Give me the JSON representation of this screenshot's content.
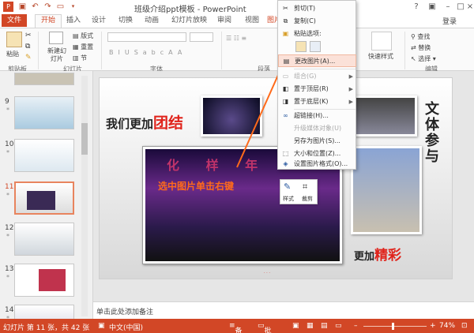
{
  "title_bar": {
    "title": "班级介绍ppt模板 - PowerPoint",
    "help": "?"
  },
  "tabs": {
    "file": "文件",
    "home": "开始",
    "insert": "插入",
    "design": "设计",
    "transitions": "切换",
    "animations": "动画",
    "slideshow": "幻灯片放映",
    "review": "审阅",
    "view": "视图",
    "picture": "图片",
    "login": "登录"
  },
  "ribbon": {
    "paste": "粘贴",
    "new_slide": "新建幻灯片",
    "layout": "版式",
    "reset": "重置",
    "section": "节",
    "quick_styles": "快速样式",
    "find": "查找",
    "replace": "替换",
    "select": "选择",
    "groups": {
      "clipboard": "剪贴板",
      "slides": "幻灯片",
      "font": "字体",
      "paragraph": "段落",
      "editing": "编辑"
    }
  },
  "thumbnails": [
    {
      "num": "9",
      "star": "*"
    },
    {
      "num": "10",
      "star": "*"
    },
    {
      "num": "11",
      "star": "*"
    },
    {
      "num": "12",
      "star": "*"
    },
    {
      "num": "13",
      "star": "*"
    },
    {
      "num": "14",
      "star": "*"
    }
  ],
  "slide": {
    "text1_a": "我们更加",
    "text1_b": "团结",
    "vertical": "文体参与",
    "text2_a": "更加",
    "text2_b": "精彩",
    "banner": "化 样 年",
    "annotation": "选中图片单击右键",
    "footer_mark": "· · ·"
  },
  "mini_toolbar": {
    "style": "样式",
    "crop": "裁剪"
  },
  "context_menu": {
    "cut": "剪切(T)",
    "copy": "复制(C)",
    "paste_options": "粘贴选项:",
    "change_picture": "更改图片(A)...",
    "group": "组合(G)",
    "bring_front": "置于顶层(R)",
    "send_back": "置于底层(K)",
    "hyperlink": "超链接(H)...",
    "upgrade_media": "升级媒体对象(U)",
    "save_as_picture": "另存为图片(S)...",
    "size_position": "大小和位置(Z)...",
    "format_picture": "设置图片格式(O)..."
  },
  "notes": {
    "placeholder": "单击此处添加备注"
  },
  "status": {
    "slide_info": "幻灯片 第 11 张，共 42 张",
    "language": "中文(中国)",
    "notes": "备注",
    "comments": "批注",
    "zoom": "74%"
  },
  "colors": {
    "accent": "#d24726",
    "highlight_red": "#e0231b"
  }
}
